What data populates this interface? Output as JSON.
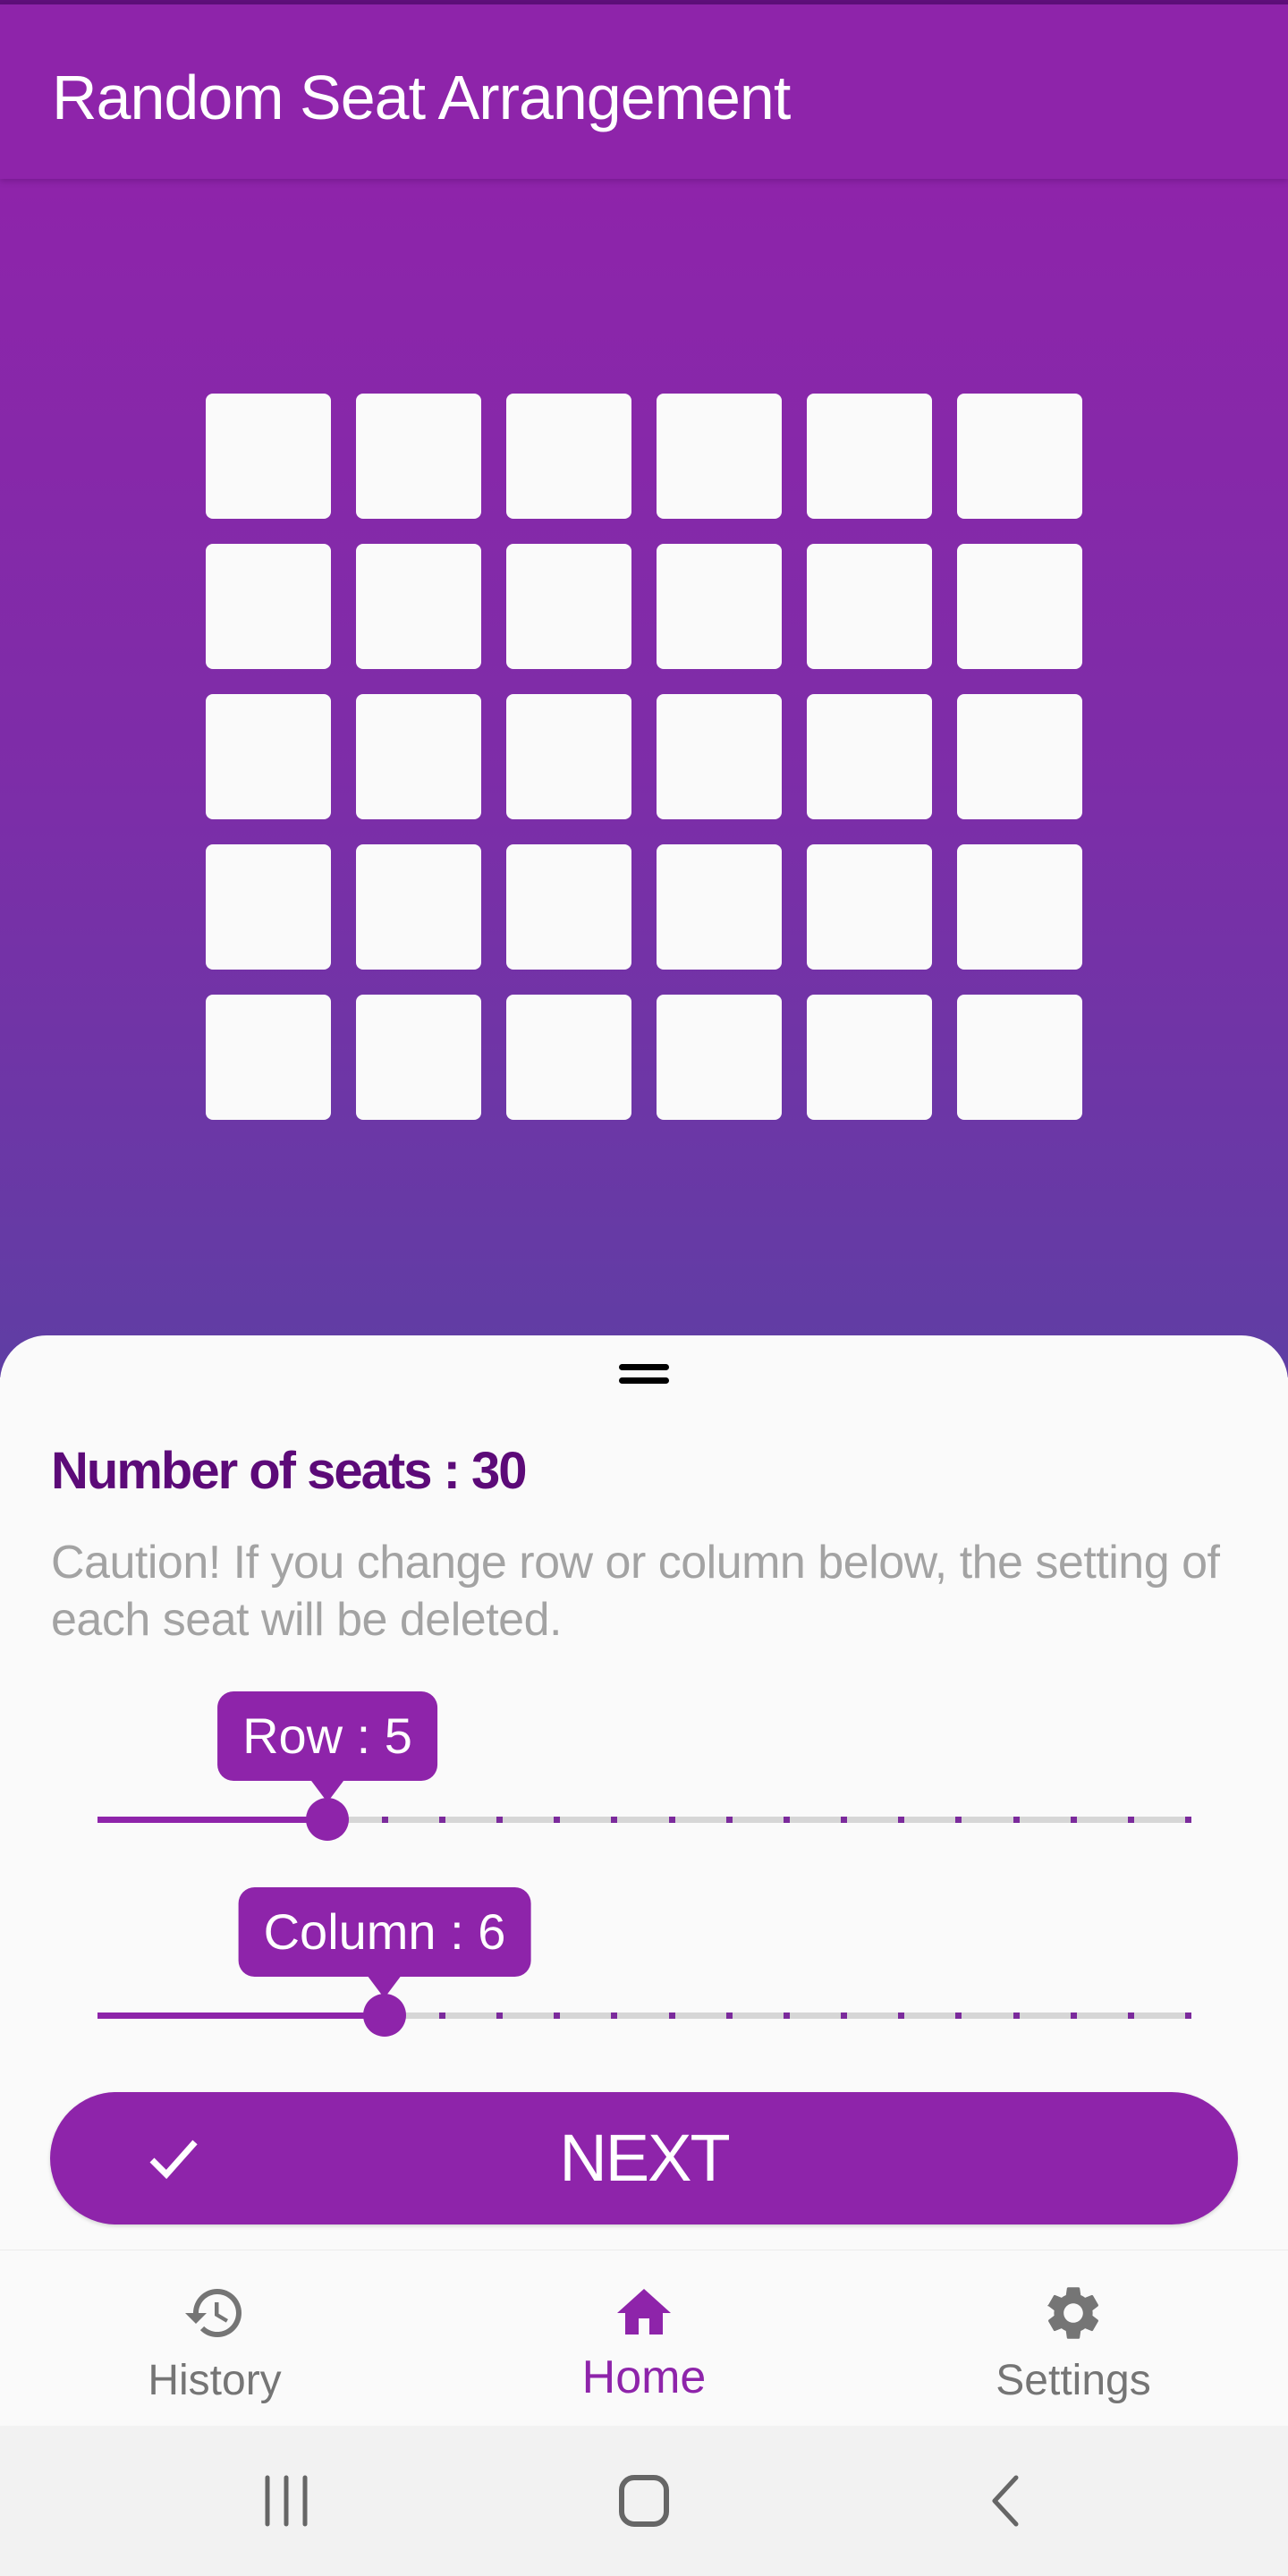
{
  "app": {
    "title": "Random Seat Arrangement"
  },
  "colors": {
    "primary": "#8e24aa",
    "primary_dark": "#5c0a78",
    "gradient_bottom": "#5f3ea4",
    "seat": "#fafafa",
    "inactive_icon": "#757575",
    "caution_text": "#a3a3a3"
  },
  "seating": {
    "rows": 5,
    "columns": 6
  },
  "sheet": {
    "seat_count_label": "Number of seats : 30",
    "caution_text": "Caution! If you change row or column below, the setting of each seat will be deleted.",
    "row_slider": {
      "label": "Row : 5",
      "value": 5,
      "min": 1,
      "max": 20
    },
    "column_slider": {
      "label": "Column : 6",
      "value": 6,
      "min": 1,
      "max": 20
    },
    "next_button": {
      "label": "NEXT",
      "icon": "check-icon"
    }
  },
  "bottom_nav": {
    "items": [
      {
        "label": "History",
        "icon": "history-icon",
        "active": false
      },
      {
        "label": "Home",
        "icon": "home-icon",
        "active": true
      },
      {
        "label": "Settings",
        "icon": "gear-icon",
        "active": false
      }
    ]
  },
  "system_nav": {
    "buttons": [
      "recent-apps-icon",
      "home-circle-icon",
      "back-icon"
    ]
  }
}
